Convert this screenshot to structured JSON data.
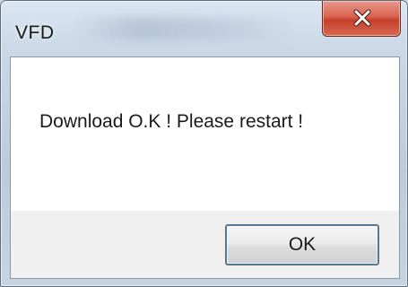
{
  "window": {
    "title": "VFD"
  },
  "dialog": {
    "message": "Download O.K ! Please restart !",
    "ok_label": "OK"
  },
  "icons": {
    "close": "close-icon"
  },
  "colors": {
    "close_button": "#c6402b",
    "dialog_background": "#ffffff",
    "footer_background": "#f0f0f0",
    "frame": "#bccbdc"
  }
}
